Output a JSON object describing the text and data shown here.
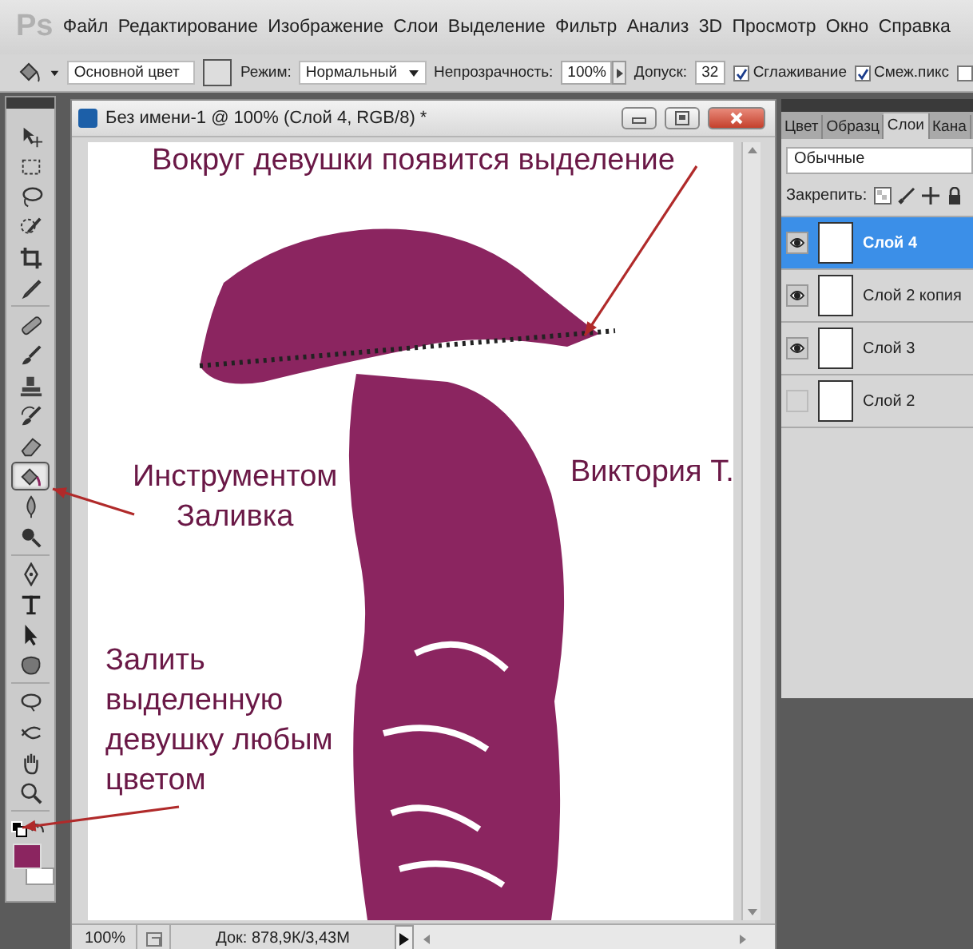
{
  "logo": "Ps",
  "menu": [
    "Файл",
    "Редактирование",
    "Изображение",
    "Слои",
    "Выделение",
    "Фильтр",
    "Анализ",
    "3D",
    "Просмотр",
    "Окно",
    "Справка"
  ],
  "options_bar": {
    "source": "Основной цвет",
    "mode_label": "Режим:",
    "mode": "Нормальный",
    "opacity_label": "Непрозрачность:",
    "opacity": "100%",
    "tolerance_label": "Допуск:",
    "tolerance": "32",
    "checkboxes": [
      {
        "label": "Сглаживание",
        "checked": true
      },
      {
        "label": "Смеж.пикс",
        "checked": true
      },
      {
        "checked": false
      }
    ]
  },
  "tool_groups": [
    {
      "tools": [
        {
          "kind": "move",
          "selected": false
        },
        {
          "kind": "marquee",
          "selected": false
        },
        {
          "kind": "lasso",
          "selected": false
        },
        {
          "kind": "quick-select",
          "selected": false
        },
        {
          "kind": "crop",
          "selected": false
        },
        {
          "kind": "eyedropper",
          "selected": false
        }
      ]
    },
    {
      "tools": [
        {
          "kind": "healing",
          "selected": false
        },
        {
          "kind": "brush",
          "selected": false
        },
        {
          "kind": "stamp",
          "selected": false
        },
        {
          "kind": "history-brush",
          "selected": false
        },
        {
          "kind": "eraser",
          "selected": false
        },
        {
          "kind": "bucket",
          "selected": true
        },
        {
          "kind": "blur",
          "selected": false
        },
        {
          "kind": "dodge",
          "selected": false
        }
      ]
    },
    {
      "tools": [
        {
          "kind": "pen",
          "selected": false
        },
        {
          "kind": "type",
          "selected": false
        },
        {
          "kind": "path-select",
          "selected": false
        },
        {
          "kind": "shape",
          "selected": false
        }
      ]
    },
    {
      "tools": [
        {
          "kind": "rotate-3d",
          "selected": false
        },
        {
          "kind": "orbit-3d",
          "selected": false
        },
        {
          "kind": "hand",
          "selected": false
        },
        {
          "kind": "zoom",
          "selected": false
        }
      ]
    }
  ],
  "document": {
    "title": "Без имени-1 @ 100% (Слой 4, RGB/8) *",
    "zoom": "100%",
    "doc_info": "Док: 878,9К/3,43М"
  },
  "annotations": [
    {
      "text": "Вокруг девушки появится выделение"
    },
    {
      "text": "Инструментом\nЗаливка"
    },
    {
      "text": "Виктория Т."
    },
    {
      "text": "Залить\nвыделенную\nдевушку любым\nцветом"
    }
  ],
  "layers_panel": {
    "tabs": [
      {
        "label": "Цвет",
        "selected": false
      },
      {
        "label": "Образц",
        "selected": false
      },
      {
        "label": "Слои",
        "selected": true
      },
      {
        "label": "Кана",
        "selected": false
      }
    ],
    "blend_mode": "Обычные",
    "lock_label": "Закрепить:",
    "layers": [
      {
        "name": "Слой 4",
        "visible": true,
        "selected": true
      },
      {
        "name": "Слой 2 копия",
        "visible": true,
        "selected": false
      },
      {
        "name": "Слой 3",
        "visible": true,
        "selected": false
      },
      {
        "name": "Слой 2",
        "visible": false,
        "selected": false
      }
    ]
  }
}
